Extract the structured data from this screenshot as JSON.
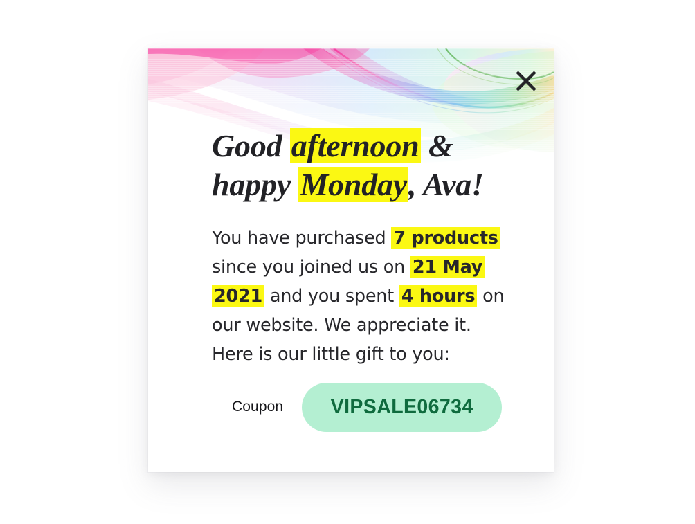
{
  "page": {
    "background_color": "#ffffff"
  },
  "modal": {
    "name": "vip-greeting-modal",
    "background_color": "#ffffff",
    "close_button": {
      "icon": "close-icon",
      "label": "×",
      "color": "#232327"
    },
    "banner": {
      "icon": "decorative-rainbow-wave",
      "colors": [
        "#f5329a",
        "#f58fc2",
        "#c9a8e8",
        "#8aa8ef",
        "#4fb6e8",
        "#45cfc2",
        "#6fd08a",
        "#cfe07a",
        "#f7c86a"
      ]
    },
    "headline": {
      "segments": [
        {
          "text": "Good ",
          "highlight": false
        },
        {
          "text": "afternoon",
          "highlight": true
        },
        {
          "text": " & happy ",
          "highlight": false
        },
        {
          "text": "Monday",
          "highlight": true
        },
        {
          "text": ", Ava!",
          "highlight": false
        }
      ],
      "plain_text": "Good afternoon & happy Monday, Ava!",
      "highlight_color": "#FBF813",
      "text_color": "#222226"
    },
    "body": {
      "segments": [
        {
          "text": "You have purchased ",
          "highlight": false
        },
        {
          "text": "7 products",
          "highlight": true
        },
        {
          "text": " since you joined us on ",
          "highlight": false
        },
        {
          "text": "21 May 2021",
          "highlight": true
        },
        {
          "text": " and you spent ",
          "highlight": false
        },
        {
          "text": "4 hours",
          "highlight": true
        },
        {
          "text": " on our website. We appreciate it. Here is our little gift to you:",
          "highlight": false
        }
      ],
      "plain_text": "You have purchased 7 products since you joined us on 21 May 2021 and you spent 4 hours on our website. We appreciate it. Here is our little gift to you:",
      "highlight_color": "#FBF813",
      "text_color": "#27272b",
      "stats": {
        "products_purchased": "7 products",
        "join_date": "21 May 2021",
        "time_spent": "4 hours",
        "user_name": "Ava",
        "greeting_time_of_day": "afternoon",
        "weekday": "Monday"
      }
    },
    "coupon": {
      "label": "Coupon",
      "code": "VIPSALE06734",
      "pill_background": "#B4EFD2",
      "code_color": "#0F6B3E"
    }
  }
}
